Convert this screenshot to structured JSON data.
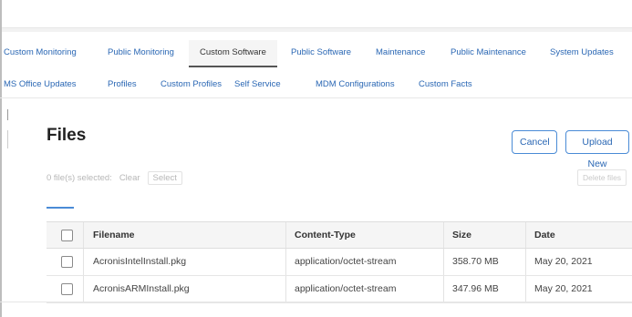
{
  "tabs_row1": [
    {
      "label": "Custom Monitoring",
      "active": false
    },
    {
      "label": "Public Monitoring",
      "active": false
    },
    {
      "label": "Custom Software",
      "active": true
    },
    {
      "label": "Public Software",
      "active": false
    },
    {
      "label": "Maintenance",
      "active": false
    },
    {
      "label": "Public Maintenance",
      "active": false
    },
    {
      "label": "System Updates",
      "active": false
    }
  ],
  "tabs_row2": [
    {
      "label": "MS Office Updates"
    },
    {
      "label": "Profiles"
    },
    {
      "label": "Custom Profiles"
    },
    {
      "label": "Self Service"
    },
    {
      "label": "MDM Configurations"
    },
    {
      "label": "Custom Facts"
    }
  ],
  "files": {
    "title": "Files",
    "cancel_label": "Cancel",
    "upload_label": "Upload New",
    "selected_text": "0 file(s) selected:",
    "clear_label": "Clear",
    "select_label": "Select",
    "delete_label": "Delete files"
  },
  "table": {
    "headers": [
      "Filename",
      "Content-Type",
      "Size",
      "Date"
    ],
    "rows": [
      {
        "filename": "AcronisIntelInstall.pkg",
        "content_type": "application/octet-stream",
        "size": "358.70 MB",
        "date": "May 20, 2021"
      },
      {
        "filename": "AcronisARMInstall.pkg",
        "content_type": "application/octet-stream",
        "size": "347.96 MB",
        "date": "May 20, 2021"
      }
    ]
  },
  "colors": {
    "accent": "#2a67b4",
    "border": "#4a8bd6"
  }
}
